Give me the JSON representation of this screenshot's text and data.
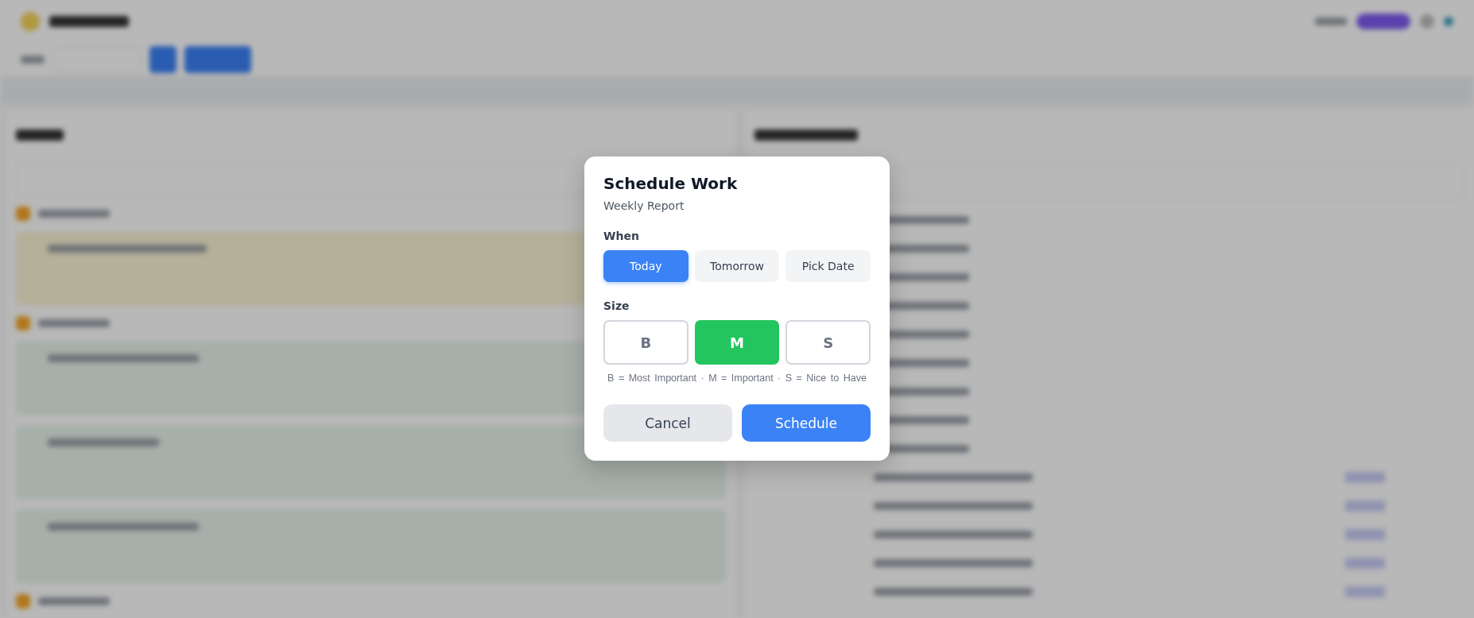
{
  "dialog": {
    "title": "Schedule Work",
    "subtitle": "Weekly Report",
    "when": {
      "label": "When",
      "options": [
        {
          "label": "Today",
          "selected": true
        },
        {
          "label": "Tomorrow",
          "selected": false
        },
        {
          "label": "Pick Date",
          "selected": false
        }
      ]
    },
    "size": {
      "label": "Size",
      "options": [
        {
          "label": "B",
          "selected": false
        },
        {
          "label": "M",
          "selected": true
        },
        {
          "label": "S",
          "selected": false
        }
      ],
      "legend": "B = Most Important · M = Important · S = Nice to Have"
    },
    "buttons": [
      {
        "label": "Cancel",
        "kind": "secondary"
      },
      {
        "label": "Schedule",
        "kind": "primary"
      }
    ]
  }
}
